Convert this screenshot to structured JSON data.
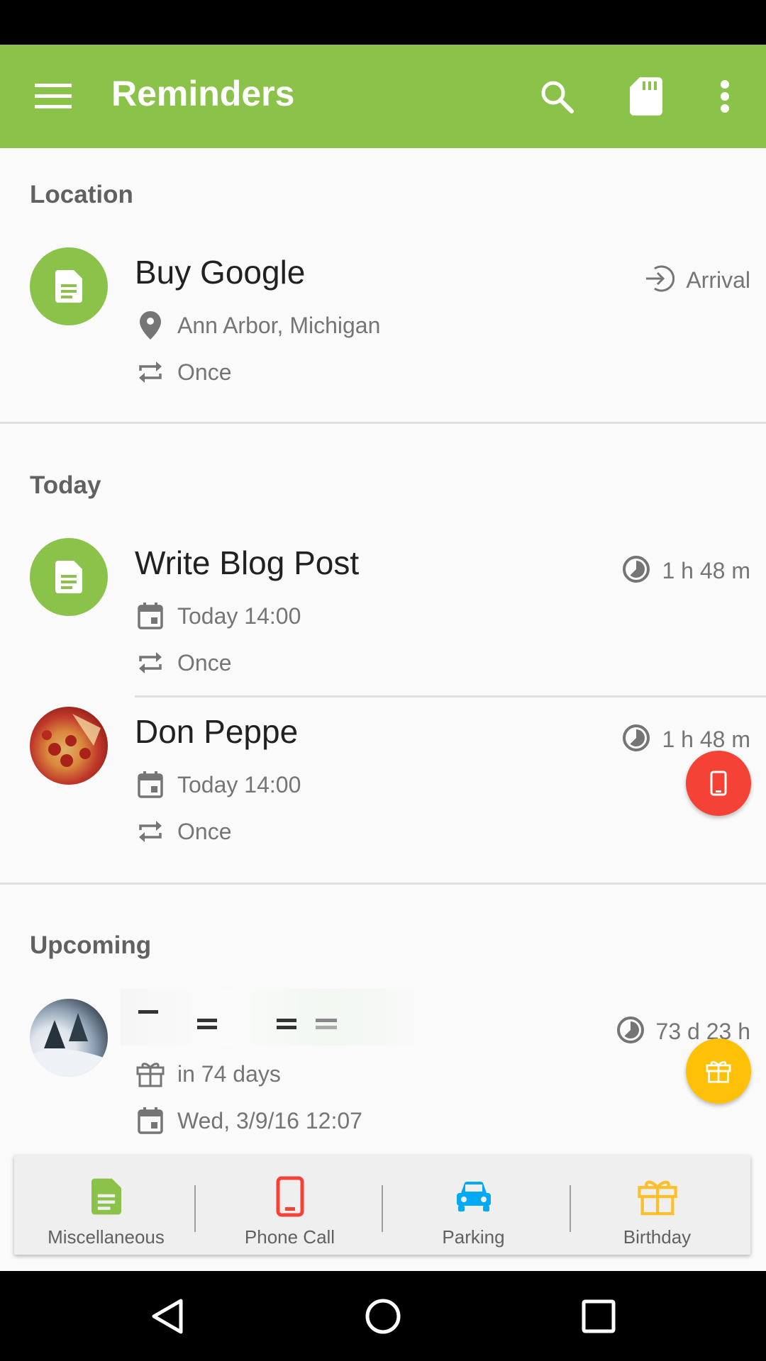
{
  "colors": {
    "accent": "#8bc34a",
    "phone": "#f44336",
    "parking": "#03a9f4",
    "birthday": "#ffc107",
    "birthday_tab": "#fbc02d"
  },
  "appbar": {
    "title": "Reminders",
    "icons": [
      "menu-icon",
      "search-icon",
      "sd-card-icon",
      "more-vert-icon"
    ]
  },
  "sections": {
    "location": {
      "header": "Location",
      "items": [
        {
          "title": "Buy Google",
          "type_icon": "note-icon",
          "meta_icon": "arrival-icon",
          "meta_text": "Arrival",
          "details": [
            {
              "icon": "place-icon",
              "text": "Ann Arbor, Michigan"
            },
            {
              "icon": "repeat-icon",
              "text": "Once"
            }
          ]
        }
      ]
    },
    "today": {
      "header": "Today",
      "items": [
        {
          "title": "Write Blog Post",
          "type_icon": "note-icon",
          "meta_icon": "timer-icon",
          "meta_text": "1 h 48 m",
          "details": [
            {
              "icon": "calendar-icon",
              "text": "Today 14:00"
            },
            {
              "icon": "repeat-icon",
              "text": "Once"
            }
          ]
        },
        {
          "title": "Don Peppe",
          "type_icon": "pizza-photo",
          "meta_icon": "timer-icon",
          "meta_text": "1 h 48 m",
          "action_icon": "phone-icon",
          "details": [
            {
              "icon": "calendar-icon",
              "text": "Today 14:00"
            },
            {
              "icon": "repeat-icon",
              "text": "Once"
            }
          ]
        }
      ]
    },
    "upcoming": {
      "header": "Upcoming",
      "items": [
        {
          "title": "",
          "type_icon": "snow-photo",
          "meta_icon": "timer-icon",
          "meta_text": "73 d 23 h",
          "action_icon": "gift-icon",
          "details": [
            {
              "icon": "gift-icon",
              "text": "in 74 days"
            },
            {
              "icon": "calendar-icon",
              "text": "Wed, 3/9/16 12:07"
            }
          ]
        }
      ]
    }
  },
  "bottom_tabs": [
    {
      "label": "Miscellaneous",
      "icon": "note-icon"
    },
    {
      "label": "Phone Call",
      "icon": "phone-icon"
    },
    {
      "label": "Parking",
      "icon": "car-icon"
    },
    {
      "label": "Birthday",
      "icon": "gift-icon"
    }
  ],
  "navbar": {
    "icons": [
      "back-icon",
      "home-icon",
      "recents-icon"
    ]
  }
}
